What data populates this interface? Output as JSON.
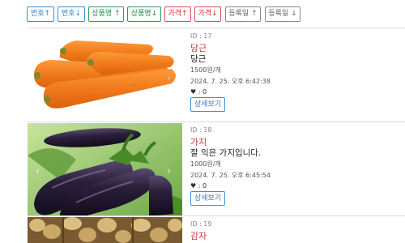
{
  "sort": {
    "buttons": [
      {
        "label": "번호↑"
      },
      {
        "label": "번호↓"
      },
      {
        "label": "상품명 ↑"
      },
      {
        "label": "상품명↓"
      },
      {
        "label": "가격↑"
      },
      {
        "label": "가격↓"
      },
      {
        "label": "등록일 ↑"
      },
      {
        "label": "등록일 ↓"
      }
    ]
  },
  "products": [
    {
      "id_text": "ID : 17",
      "name": "당근",
      "desc": "당근",
      "price": "1500원/개",
      "date": "2024. 7. 25. 오후 6:42:38",
      "likes": ": 0",
      "button": "상세보기"
    },
    {
      "id_text": "ID : 18",
      "name": "가지",
      "desc": "잘 익은 가지입니다.",
      "price": "1000원/개",
      "date": "2024. 7. 25. 오후 6:45:54",
      "likes": ": 0",
      "button": "상세보기"
    },
    {
      "id_text": "ID : 19",
      "name": "감자"
    }
  ],
  "icons": {
    "heart": "heart-icon",
    "prev": "chevron-left-icon",
    "next": "chevron-right-icon"
  }
}
